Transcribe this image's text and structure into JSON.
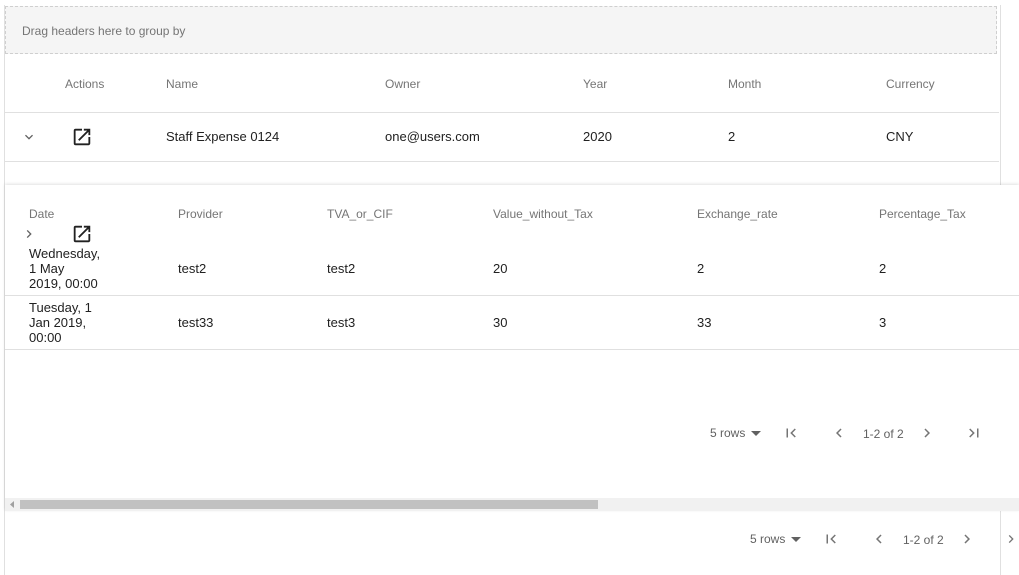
{
  "grid": {
    "group_panel_text": "Drag headers here to group by",
    "columns": [
      "Actions",
      "Name",
      "Owner",
      "Year",
      "Month",
      "Currency"
    ],
    "row": {
      "name": "Staff Expense 0124",
      "owner": "one@users.com",
      "year": "2020",
      "month": "2",
      "currency": "CNY"
    },
    "pager": {
      "rows_per_page": "5 rows",
      "range": "1-2 of 2"
    }
  },
  "detail": {
    "columns": [
      "Date",
      "Provider",
      "TVA_or_CIF",
      "Value_without_Tax",
      "Exchange_rate",
      "Percentage_Tax"
    ],
    "rows": [
      {
        "date_lines": [
          "Wednesday,",
          "1 May",
          "2019, 00:00"
        ],
        "provider": "test2",
        "tva": "test2",
        "value": "20",
        "exchange": "2",
        "percentage": "2"
      },
      {
        "date_lines": [
          "Tuesday, 1",
          "Jan 2019,",
          "00:00"
        ],
        "provider": "test33",
        "tva": "test3",
        "value": "30",
        "exchange": "33",
        "percentage": "3"
      }
    ],
    "pager": {
      "rows_per_page": "5 rows",
      "range": "1-2 of 2"
    }
  },
  "icons": {
    "collapse": "chevron-down-icon",
    "expand": "chevron-right-icon",
    "open": "open-in-new-icon",
    "first": "first-page-icon",
    "prev": "chevron-left-icon",
    "next": "chevron-right-icon",
    "last": "last-page-icon"
  }
}
